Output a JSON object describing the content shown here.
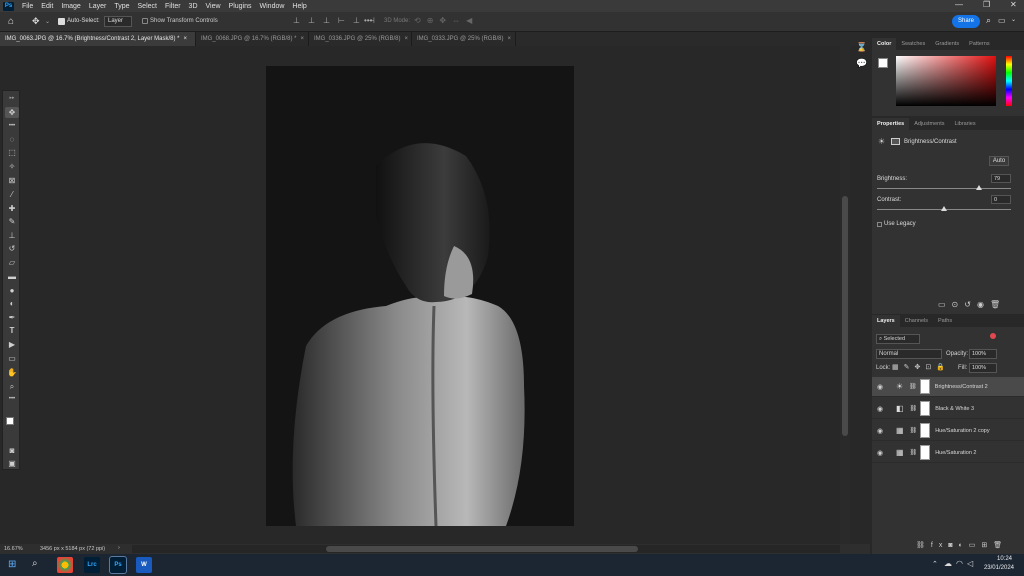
{
  "app": {
    "logo": "Ps"
  },
  "menu": [
    "File",
    "Edit",
    "Image",
    "Layer",
    "Type",
    "Select",
    "Filter",
    "3D",
    "View",
    "Plugins",
    "Window",
    "Help"
  ],
  "window_controls": {
    "min": "—",
    "max": "❐",
    "close": "✕"
  },
  "options": {
    "auto_select_label": "Auto-Select:",
    "auto_select_value": "Layer",
    "transform_label": "Show Transform Controls",
    "mode_3d": "3D Mode:",
    "share": "Share"
  },
  "tabs": [
    {
      "label": "IMG_0063.JPG @ 16.7% (Brightness/Contrast 2, Layer Mask/8) *",
      "close": "×"
    },
    {
      "label": "IMG_0068.JPG @ 16.7% (RGB/8) *",
      "close": "×"
    },
    {
      "label": "IMG_0336.JPG @ 25% (RGB/8)",
      "close": "×"
    },
    {
      "label": "IMG_0333.JPG @ 25% (RGB/8)",
      "close": "×"
    }
  ],
  "status": {
    "zoom": "16.67%",
    "doc_info": "3456 px x 5184 px (72 ppi)",
    "arrow": "›"
  },
  "color_panel": {
    "tabs": [
      "Color",
      "Swatches",
      "Gradients",
      "Patterns"
    ]
  },
  "properties_panel": {
    "tabs": [
      "Properties",
      "Adjustments",
      "Libraries"
    ],
    "adjustment": "Brightness/Contrast",
    "auto_label": "Auto",
    "brightness_label": "Brightness:",
    "brightness_value": "79",
    "contrast_label": "Contrast:",
    "contrast_value": "0",
    "legacy_label": "Use Legacy",
    "brightness_slider_fraction": 0.76,
    "contrast_slider_fraction": 0.5
  },
  "layers_panel": {
    "tabs": [
      "Layers",
      "Channels",
      "Paths"
    ],
    "filter_kind": "Selected",
    "blend_mode": "Normal",
    "opacity_label": "Opacity:",
    "opacity_value": "100%",
    "lock_label": "Lock:",
    "fill_label": "Fill:",
    "fill_value": "100%",
    "layers": [
      {
        "name": "Brightness/Contrast 2",
        "selected": true
      },
      {
        "name": "Black & White 3",
        "selected": false
      },
      {
        "name": "Hue/Saturation 2 copy",
        "selected": false
      },
      {
        "name": "Hue/Saturation 2",
        "selected": false
      }
    ]
  },
  "taskbar": {
    "apps": [
      "Lrc",
      "Ps",
      "W"
    ],
    "time": "10:24",
    "date": "23/01/2024"
  },
  "colors": {
    "accent": "#1473e6",
    "ps_blue": "#31a8ff",
    "panel": "#323232"
  }
}
